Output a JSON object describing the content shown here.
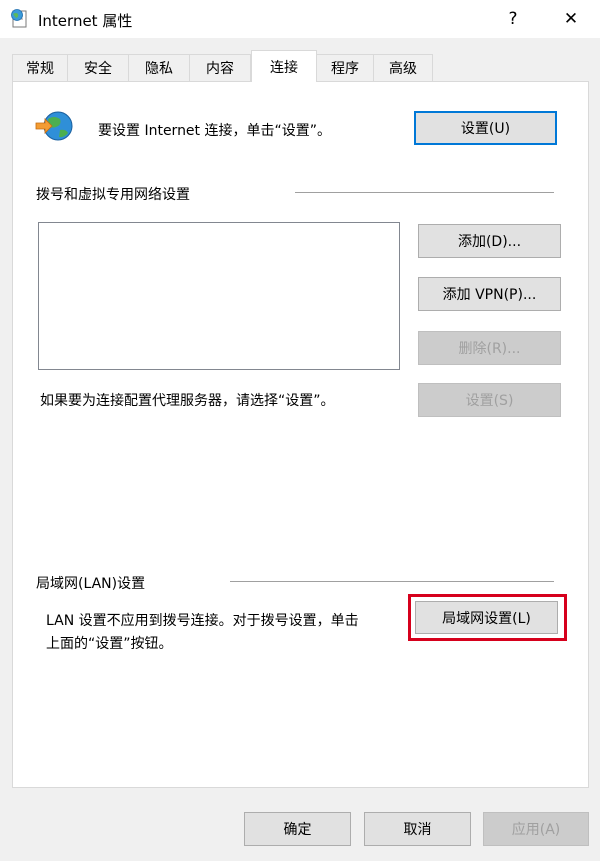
{
  "window": {
    "title": "Internet 属性",
    "help": "?",
    "close": "✕",
    "icon": "internet-options-icon"
  },
  "tabs": [
    "常规",
    "安全",
    "隐私",
    "内容",
    "连接",
    "程序",
    "高级"
  ],
  "active_tab": "连接",
  "setup": {
    "text": "要设置 Internet 连接，单击“设置”。",
    "button": "设置(U)",
    "icon": "globe-arrow-icon"
  },
  "dialup": {
    "heading": "拨号和虚拟专用网络设置",
    "add": "添加(D)...",
    "add_vpn": "添加 VPN(P)...",
    "remove": "删除(R)...",
    "proxy_text": "如果要为连接配置代理服务器，请选择“设置”。",
    "settings": "设置(S)"
  },
  "lan": {
    "heading": "局域网(LAN)设置",
    "text_line1": "LAN 设置不应用到拨号连接。对于拨号设置，单击",
    "text_line2": "上面的“设置”按钮。",
    "button": "局域网设置(L)",
    "highlight_color": "#d6001c"
  },
  "footer": {
    "ok": "确定",
    "cancel": "取消",
    "apply": "应用(A)"
  },
  "colors": {
    "accent": "#0078d7",
    "disabled_text": "#a0a0a0"
  }
}
